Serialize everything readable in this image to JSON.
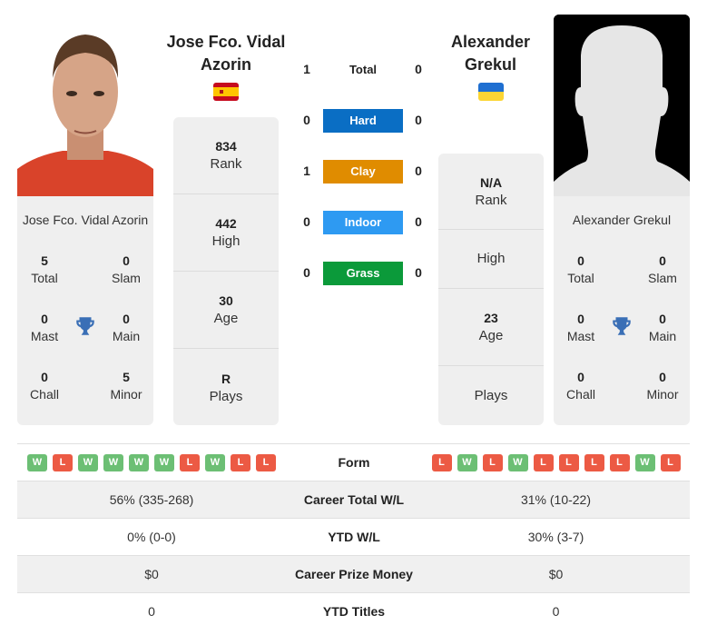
{
  "colors": {
    "hard": "#0a6ec4",
    "clay": "#e08c00",
    "indoor": "#2e9af2",
    "grass": "#0b9a3a",
    "win": "#6cbf74",
    "loss": "#ec5a44",
    "trophy": "#3a6fb6"
  },
  "player_left": {
    "name": "Jose Fco. Vidal Azorin",
    "flag": "spain-flag",
    "card_name": "Jose Fco. Vidal Azorin",
    "titles": [
      {
        "value": "5",
        "label": "Total"
      },
      {
        "value": "0",
        "label": "Slam"
      },
      {
        "value": "0",
        "label": "Mast"
      },
      {
        "value": "0",
        "label": "Main"
      },
      {
        "value": "0",
        "label": "Chall"
      },
      {
        "value": "5",
        "label": "Minor"
      }
    ],
    "stats": [
      {
        "value": "834",
        "label": "Rank"
      },
      {
        "value": "442",
        "label": "High"
      },
      {
        "value": "30",
        "label": "Age"
      },
      {
        "value": "R",
        "label": "Plays"
      }
    ],
    "form": [
      "W",
      "L",
      "W",
      "W",
      "W",
      "W",
      "L",
      "W",
      "L",
      "L"
    ]
  },
  "player_right": {
    "name": "Alexander Grekul",
    "flag": "ukraine-flag",
    "card_name": "Alexander Grekul",
    "titles": [
      {
        "value": "0",
        "label": "Total"
      },
      {
        "value": "0",
        "label": "Slam"
      },
      {
        "value": "0",
        "label": "Mast"
      },
      {
        "value": "0",
        "label": "Main"
      },
      {
        "value": "0",
        "label": "Chall"
      },
      {
        "value": "0",
        "label": "Minor"
      }
    ],
    "stats": [
      {
        "value": "N/A",
        "label": "Rank"
      },
      {
        "value": "",
        "label": "High"
      },
      {
        "value": "23",
        "label": "Age"
      },
      {
        "value": "",
        "label": "Plays"
      }
    ],
    "form": [
      "L",
      "W",
      "L",
      "W",
      "L",
      "L",
      "L",
      "L",
      "W",
      "L"
    ]
  },
  "h2h": [
    {
      "label": "Total",
      "left": "1",
      "right": "0",
      "surface": "total"
    },
    {
      "label": "Hard",
      "left": "0",
      "right": "0",
      "surface": "hard"
    },
    {
      "label": "Clay",
      "left": "1",
      "right": "0",
      "surface": "clay"
    },
    {
      "label": "Indoor",
      "left": "0",
      "right": "0",
      "surface": "indoor"
    },
    {
      "label": "Grass",
      "left": "0",
      "right": "0",
      "surface": "grass"
    }
  ],
  "table": {
    "form_label": "Form",
    "rows": [
      {
        "left": "56% (335-268)",
        "label": "Career Total W/L",
        "right": "31% (10-22)"
      },
      {
        "left": "0% (0-0)",
        "label": "YTD W/L",
        "right": "30% (3-7)"
      },
      {
        "left": "$0",
        "label": "Career Prize Money",
        "right": "$0"
      },
      {
        "left": "0",
        "label": "YTD Titles",
        "right": "0"
      }
    ]
  }
}
